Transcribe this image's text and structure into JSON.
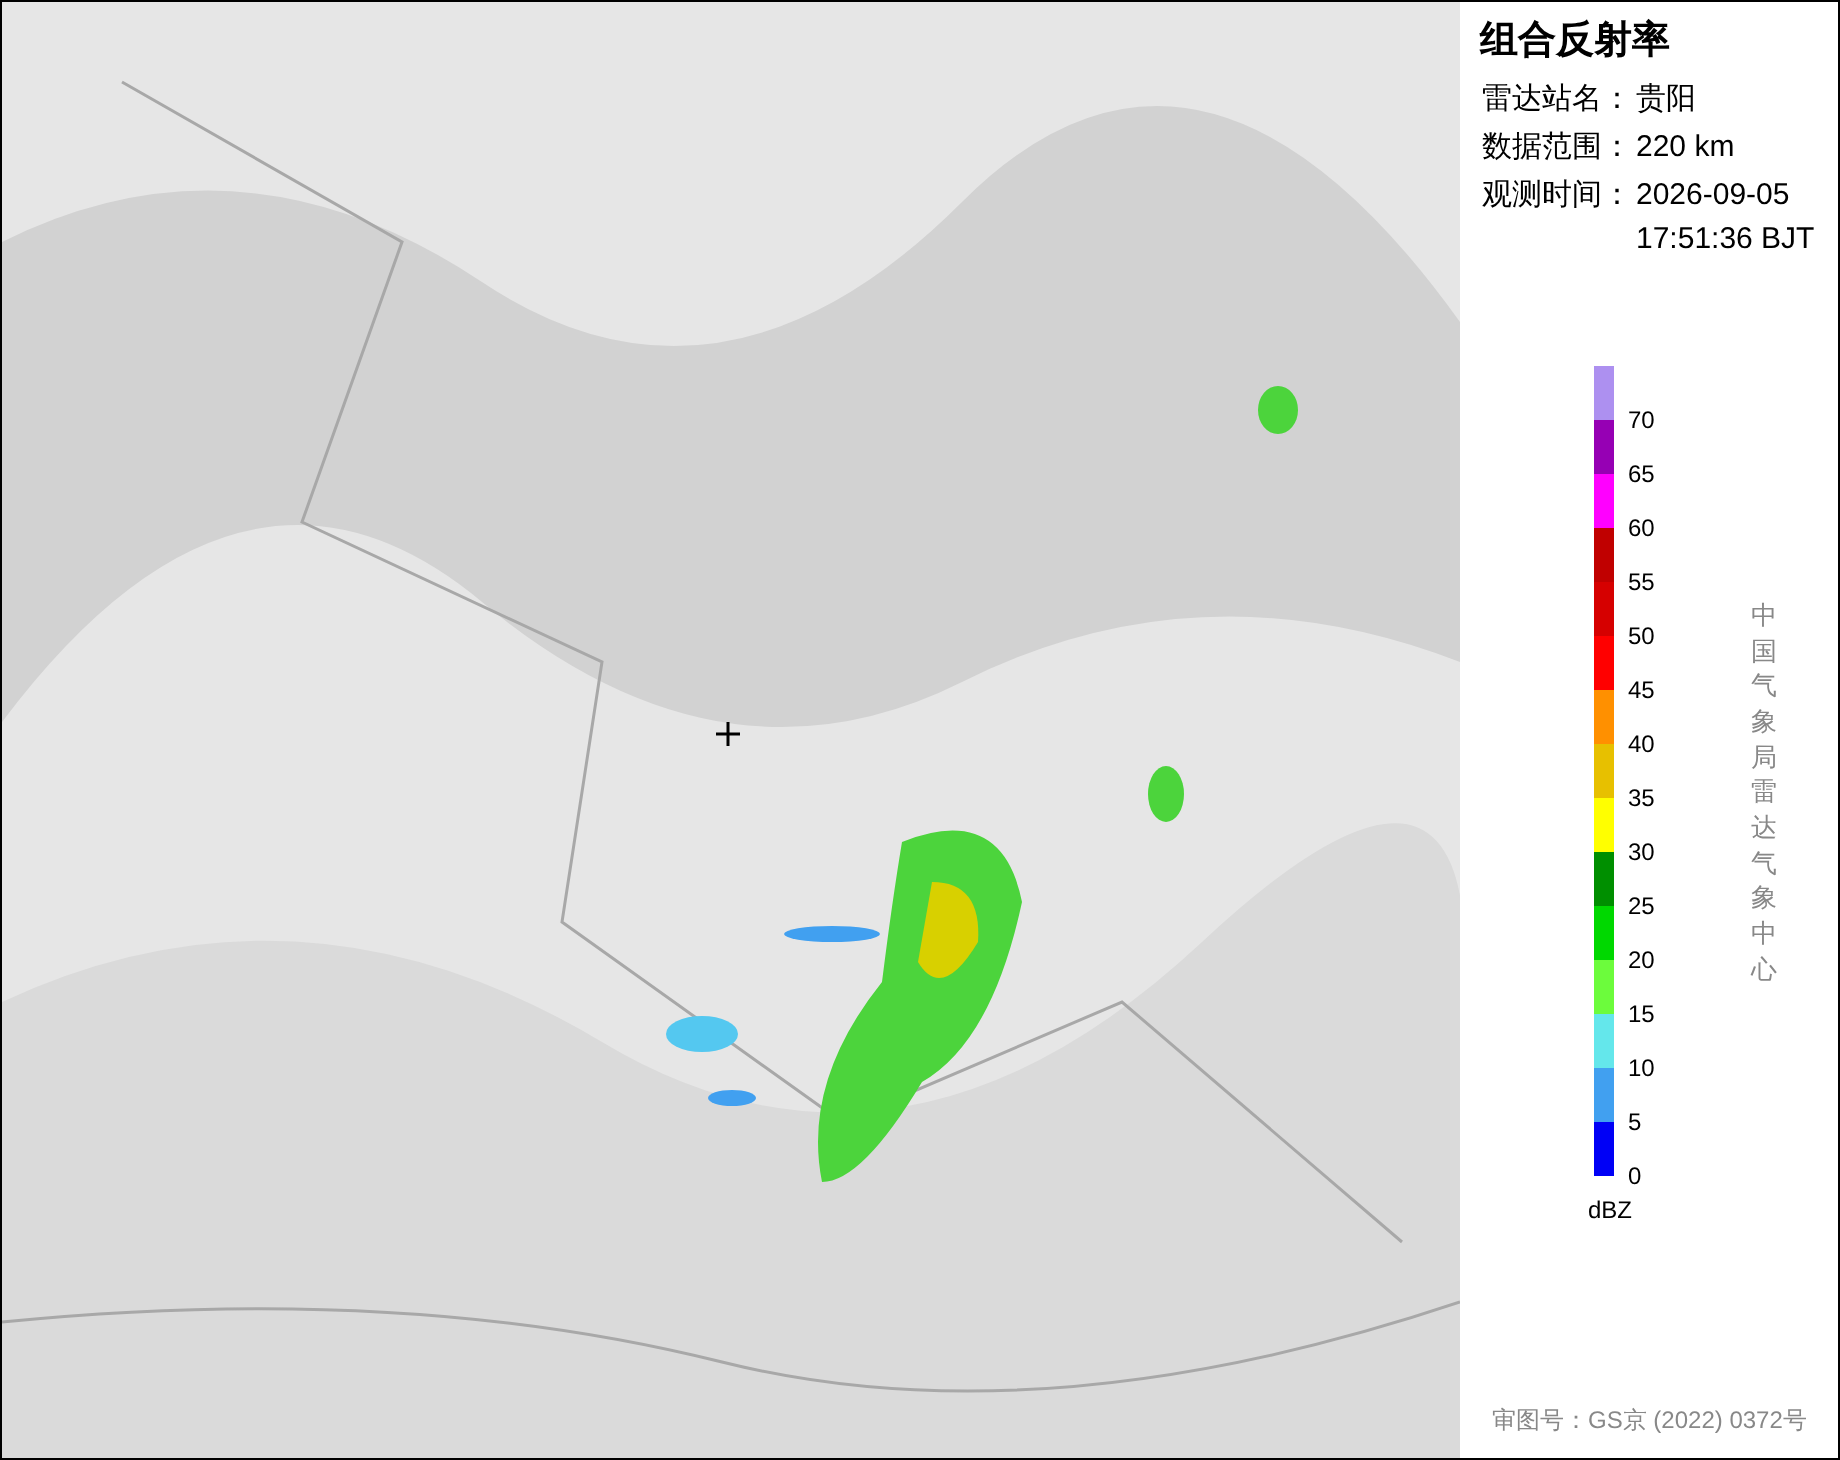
{
  "panel": {
    "title": "组合反射率",
    "info": [
      {
        "label": "雷达站名：",
        "value": "贵阳"
      },
      {
        "label": "数据范围：",
        "value": "220 km"
      },
      {
        "label": "观测时间：",
        "value": "2026-09-05\n17:51:36 BJT"
      }
    ],
    "legend": [
      {
        "label": "70",
        "color": "#ad90f0"
      },
      {
        "label": "65",
        "color": "#9600b4"
      },
      {
        "label": "60",
        "color": "#ff00ff"
      },
      {
        "label": "55",
        "color": "#c00000"
      },
      {
        "label": "50",
        "color": "#d60000"
      },
      {
        "label": "45",
        "color": "#ff0000"
      },
      {
        "label": "40",
        "color": "#ff9000"
      },
      {
        "label": "35",
        "color": "#e7c000"
      },
      {
        "label": "30",
        "color": "#ffff00"
      },
      {
        "label": "25",
        "color": "#008f00"
      },
      {
        "label": "20",
        "color": "#00d800"
      },
      {
        "label": "15",
        "color": "#6cfc3c"
      },
      {
        "label": "10",
        "color": "#64e7eb"
      },
      {
        "label": "5",
        "color": "#41a0f0"
      },
      {
        "label": "0",
        "color": "#0000f6"
      }
    ],
    "unit": "dBZ",
    "source": "中国气象局雷达气象中心",
    "approval": "审图号：GS京 (2022) 0372号"
  }
}
